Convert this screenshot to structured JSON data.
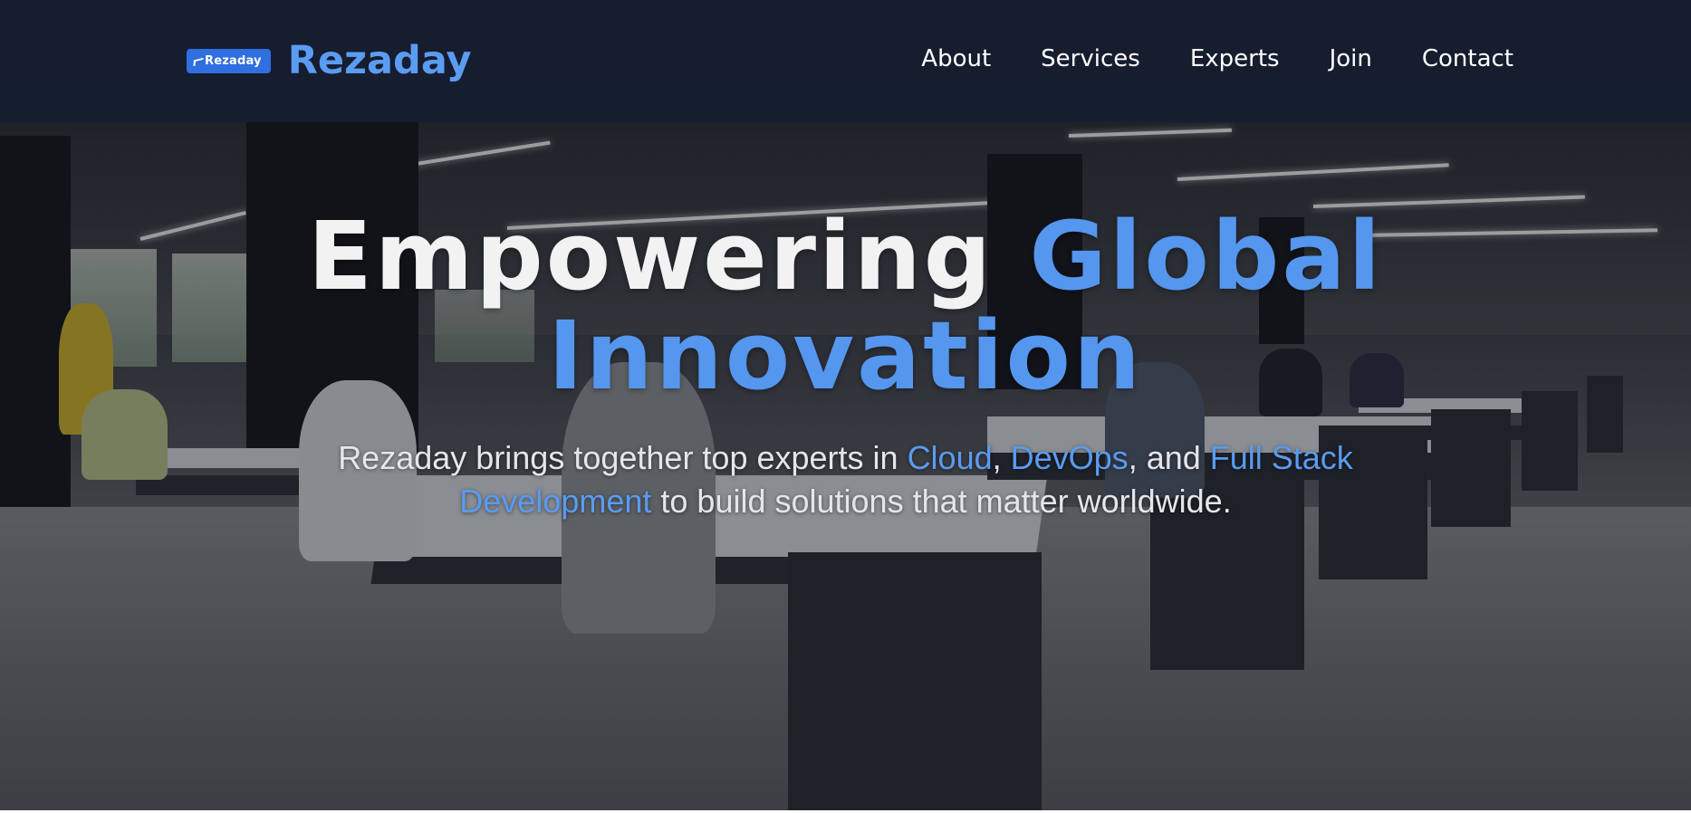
{
  "brand": {
    "badge_text": "Rezaday",
    "name": "Rezaday",
    "accent_color": "#5b9cf2"
  },
  "nav": {
    "items": [
      {
        "label": "About"
      },
      {
        "label": "Services"
      },
      {
        "label": "Experts"
      },
      {
        "label": "Join"
      },
      {
        "label": "Contact"
      }
    ]
  },
  "hero": {
    "title_plain": "Empowering ",
    "title_accent_1": "Global",
    "title_accent_2": "Innovation",
    "subtitle": {
      "part_1": "Rezaday brings together top experts in ",
      "hl_1": "Cloud",
      "sep_1": ", ",
      "hl_2": "DevOps",
      "sep_2": ", and ",
      "hl_3": "Full Stack Development",
      "part_2": " to build solutions that matter worldwide."
    },
    "accent_color": "#5596ee",
    "background_image": "open-plan office with people working at desks"
  },
  "colors": {
    "header_bg": "#161e30",
    "badge_bg": "#2f6fe0",
    "text": "#ffffff"
  }
}
